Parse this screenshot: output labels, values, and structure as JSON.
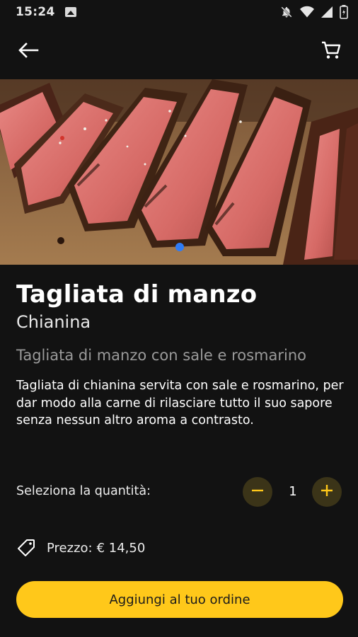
{
  "status_bar": {
    "time": "15:24",
    "icons": [
      "gallery-icon",
      "notifications-off-icon",
      "wifi-icon",
      "signal-icon",
      "battery-icon"
    ]
  },
  "toolbar": {
    "back_icon": "arrow-left-icon",
    "cart_icon": "cart-icon"
  },
  "hero": {
    "carousel_active_index": 0,
    "dot_color": "#2f7cf6"
  },
  "product": {
    "title": "Tagliata di manzo",
    "subtitle": "Chianina",
    "short_description": "Tagliata di manzo con sale e rosmarino",
    "description": "Tagliata di chianina servita con sale e rosmarino, per dar modo alla carne di rilasciare tutto il suo sapore senza nessun altro aroma a contrasto."
  },
  "quantity": {
    "label": "Seleziona la quantità:",
    "value": "1",
    "minus_icon": "minus-icon",
    "plus_icon": "plus-icon"
  },
  "price": {
    "icon": "tag-icon",
    "label": "Prezzo:",
    "value": "€ 14,50"
  },
  "add_button": {
    "label": "Aggiungi al tuo ordine",
    "color": "#ffc81a"
  },
  "colors": {
    "background": "#121212",
    "accent": "#ffc81a",
    "qty_button_bg": "#3b3418"
  }
}
